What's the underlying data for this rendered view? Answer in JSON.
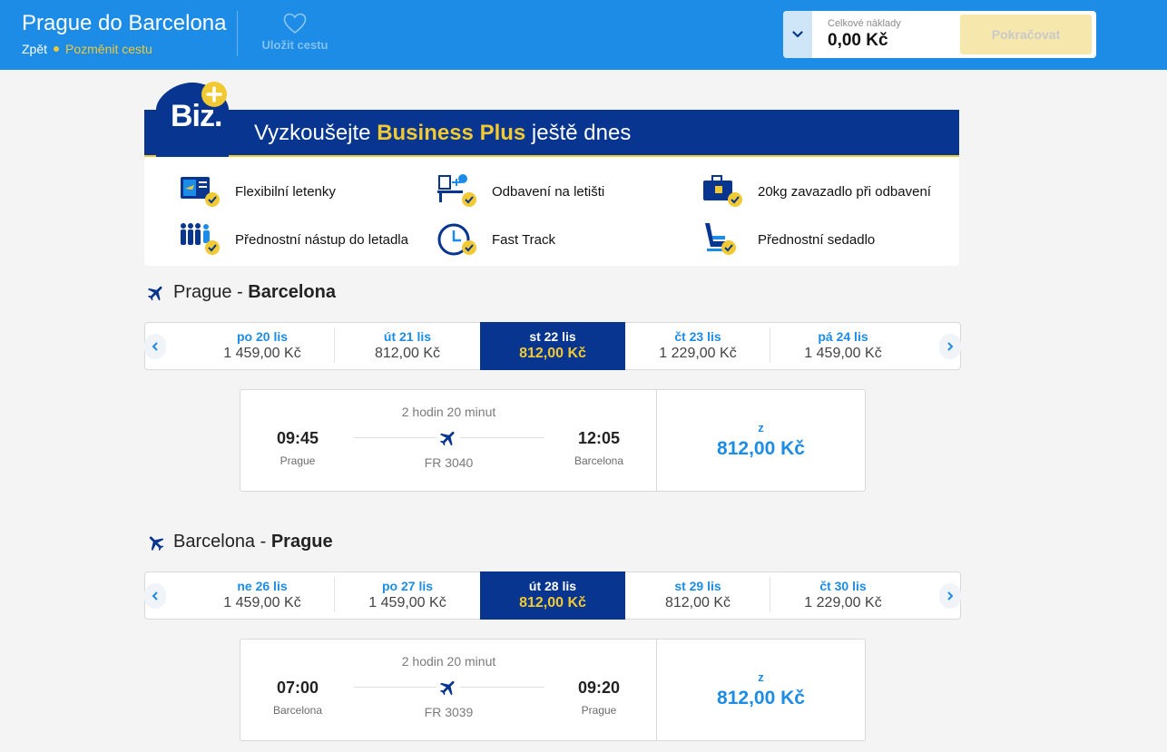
{
  "header": {
    "title": "Prague do Barcelona",
    "back_label": "Zpět",
    "change_label": "Pozměnit cestu",
    "save_label": "Uložit cestu",
    "cost_label": "Celkové náklady",
    "cost_value": "0,00 Kč",
    "continue_label": "Pokračovat"
  },
  "promo": {
    "badge_text": "Biz.",
    "headline_before": "Vyzkoušejte",
    "headline_highlight": "Business Plus",
    "headline_after": "ještě dnes",
    "features": [
      {
        "label": "Flexibilní letenky",
        "icon": "flexible-ticket-icon"
      },
      {
        "label": "Odbavení na letišti",
        "icon": "airport-checkin-icon"
      },
      {
        "label": "20kg zavazadlo při odbavení",
        "icon": "checked-bag-icon"
      },
      {
        "label": "Přednostní nástup do letadla",
        "icon": "priority-boarding-icon"
      },
      {
        "label": "Fast Track",
        "icon": "fast-track-icon"
      },
      {
        "label": "Přednostní sedadlo",
        "icon": "priority-seat-icon"
      }
    ]
  },
  "outbound": {
    "from": "Prague",
    "separator": " - ",
    "to": "Barcelona",
    "dates": [
      {
        "day": "po 20 lis",
        "price": "1 459,00 Kč",
        "selected": false
      },
      {
        "day": "út 21 lis",
        "price": "812,00 Kč",
        "selected": false
      },
      {
        "day": "st 22 lis",
        "price": "812,00 Kč",
        "selected": true
      },
      {
        "day": "čt 23 lis",
        "price": "1 229,00 Kč",
        "selected": false
      },
      {
        "day": "pá 24 lis",
        "price": "1 459,00 Kč",
        "selected": false
      }
    ],
    "flight": {
      "duration": "2 hodin 20 minut",
      "depart_time": "09:45",
      "depart_city": "Prague",
      "arrive_time": "12:05",
      "arrive_city": "Barcelona",
      "flight_number": "FR 3040",
      "price_prefix": "z",
      "price": "812,00 Kč"
    }
  },
  "inbound": {
    "from": "Barcelona",
    "separator": " - ",
    "to": "Prague",
    "dates": [
      {
        "day": "ne 26 lis",
        "price": "1 459,00 Kč",
        "selected": false
      },
      {
        "day": "po 27 lis",
        "price": "1 459,00 Kč",
        "selected": false
      },
      {
        "day": "út 28 lis",
        "price": "812,00 Kč",
        "selected": true
      },
      {
        "day": "st 29 lis",
        "price": "812,00 Kč",
        "selected": false
      },
      {
        "day": "čt 30 lis",
        "price": "1 229,00 Kč",
        "selected": false
      }
    ],
    "flight": {
      "duration": "2 hodin 20 minut",
      "depart_time": "07:00",
      "depart_city": "Barcelona",
      "arrive_time": "09:20",
      "arrive_city": "Prague",
      "flight_number": "FR 3039",
      "price_prefix": "z",
      "price": "812,00 Kč"
    }
  },
  "colors": {
    "header_blue": "#1d8ce6",
    "navy": "#073590",
    "yellow": "#f1c933"
  }
}
